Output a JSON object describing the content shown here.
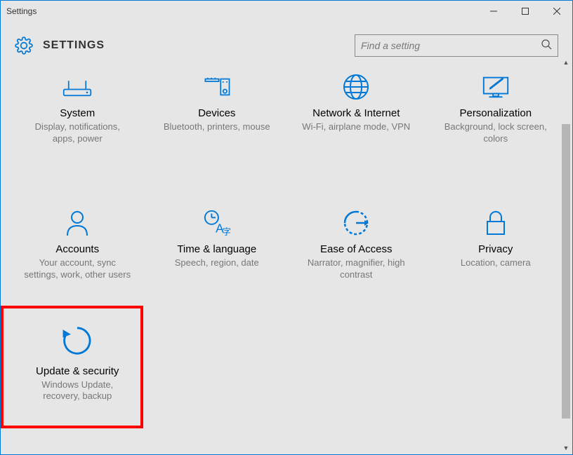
{
  "window_title": "Settings",
  "header_title": "SETTINGS",
  "search_placeholder": "Find a setting",
  "tiles": [
    {
      "key": "system",
      "title": "System",
      "desc": "Display, notifications, apps, power"
    },
    {
      "key": "devices",
      "title": "Devices",
      "desc": "Bluetooth, printers, mouse"
    },
    {
      "key": "network",
      "title": "Network & Internet",
      "desc": "Wi-Fi, airplane mode, VPN"
    },
    {
      "key": "personalization",
      "title": "Personalization",
      "desc": "Background, lock screen, colors"
    },
    {
      "key": "accounts",
      "title": "Accounts",
      "desc": "Your account, sync settings, work, other users"
    },
    {
      "key": "time",
      "title": "Time & language",
      "desc": "Speech, region, date"
    },
    {
      "key": "ease",
      "title": "Ease of Access",
      "desc": "Narrator, magnifier, high contrast"
    },
    {
      "key": "privacy",
      "title": "Privacy",
      "desc": "Location, camera"
    },
    {
      "key": "update",
      "title": "Update & security",
      "desc": "Windows Update, recovery, backup"
    }
  ],
  "accent_color": "#0078d7",
  "highlight_color": "#ff0000"
}
